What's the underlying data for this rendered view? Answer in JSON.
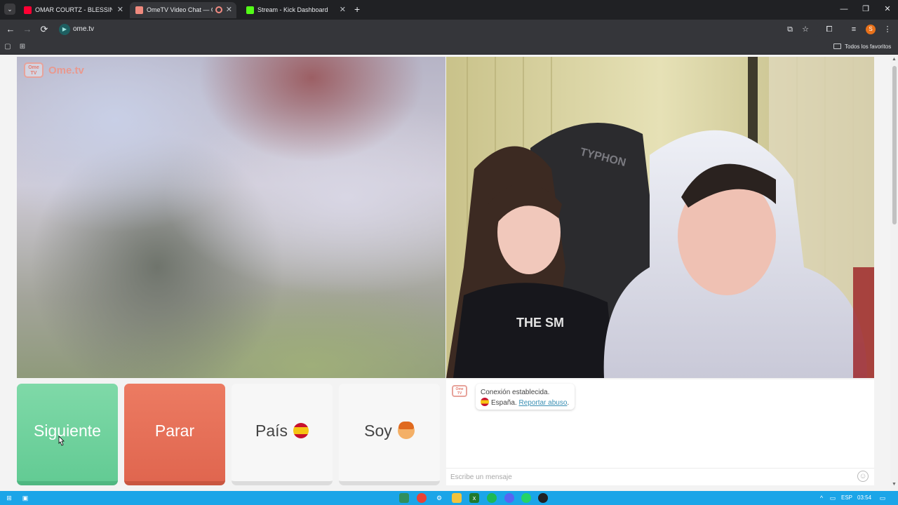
{
  "browser": {
    "tabs": [
      {
        "title": "OMAR COURTZ - BLESSINGS (V",
        "active": false,
        "favicon_color": "#ff0033"
      },
      {
        "title": "OmeTV Video Chat — Ome",
        "active": true,
        "favicon_color": "#f08a7e"
      },
      {
        "title": "Stream - Kick Dashboard",
        "active": false,
        "favicon_color": "#53fc18"
      }
    ],
    "new_tab_icon": "+",
    "window_controls": {
      "minimize": "—",
      "restore": "❐",
      "close": "✕"
    },
    "nav": {
      "back": "←",
      "forward": "→",
      "reload": "⟳"
    },
    "url": "ome.tv",
    "profile_initial": "S",
    "bookmarks_all_label": "Todos los favoritos"
  },
  "brand": {
    "logo_box": "Ome TV",
    "logo_word": "Ome.tv",
    "accent": "#e47c70"
  },
  "controls": {
    "next_label": "Siguiente",
    "stop_label": "Parar",
    "country_label": "País",
    "gender_label": "Soy",
    "next_color": "#6fd29f",
    "stop_color": "#e6705a"
  },
  "chat": {
    "status_text": "Conexión establecida.",
    "country_text": "España.",
    "report_link": "Reportar abuso",
    "report_suffix": ".",
    "input_placeholder": "Escribe un mensaje"
  },
  "remote_video": {
    "hoodie_text": "THE SM",
    "chair_text": "TYPHON"
  },
  "taskbar": {
    "language": "ESP",
    "time": "03:54"
  }
}
